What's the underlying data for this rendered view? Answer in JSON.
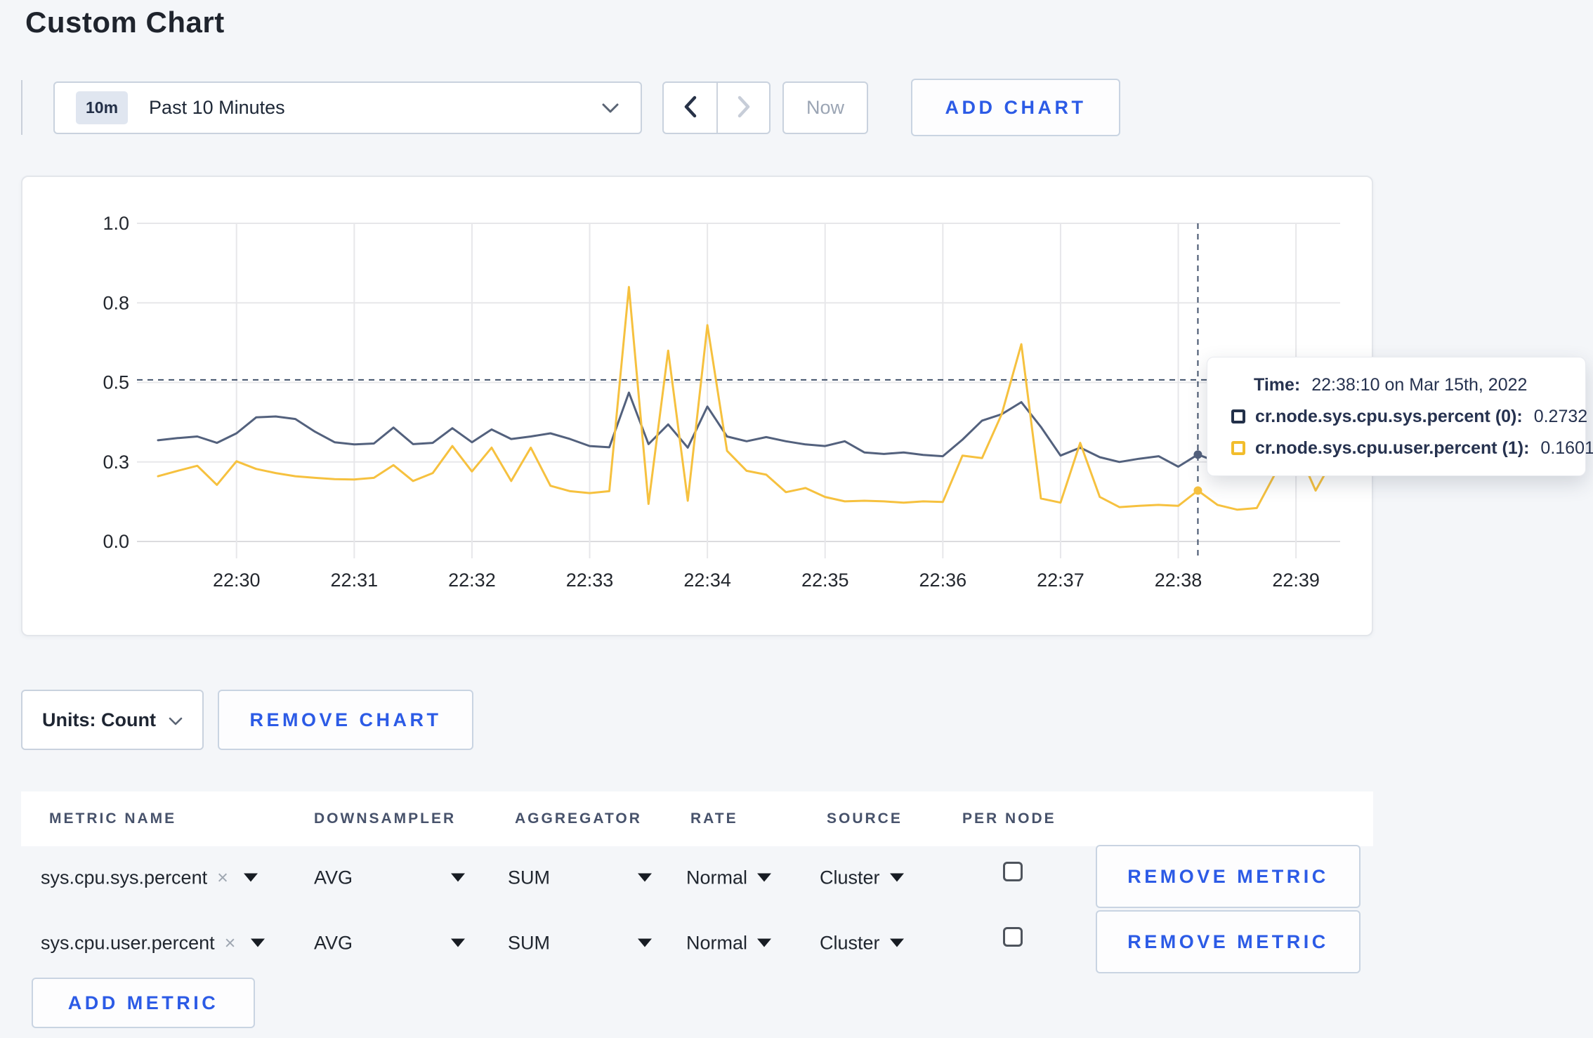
{
  "page": {
    "title": "Custom Chart"
  },
  "toolbar": {
    "time_badge": "10m",
    "time_label": "Past 10 Minutes",
    "prev_label": "previous time range",
    "next_label": "next time range",
    "now_label": "Now",
    "add_chart_label": "ADD CHART"
  },
  "chart_controls": {
    "units_label": "Units: Count",
    "remove_chart_label": "REMOVE CHART"
  },
  "tooltip": {
    "time_label": "Time:",
    "time_value": "22:38:10 on Mar 15th, 2022",
    "series": [
      {
        "label": "cr.node.sys.cpu.sys.percent (0):",
        "value": "0.2732",
        "color": "#223049"
      },
      {
        "label": "cr.node.sys.cpu.user.percent (1):",
        "value": "0.1601",
        "color": "#f2bd2c"
      }
    ]
  },
  "metrics_table": {
    "headers": [
      "METRIC NAME",
      "DOWNSAMPLER",
      "AGGREGATOR",
      "RATE",
      "SOURCE",
      "PER NODE"
    ],
    "rows": [
      {
        "metric": "sys.cpu.sys.percent",
        "remove_tag": "×",
        "downsampler": "AVG",
        "aggregator": "SUM",
        "rate": "Normal",
        "source": "Cluster",
        "per_node_checked": false,
        "remove_label": "REMOVE METRIC"
      },
      {
        "metric": "sys.cpu.user.percent",
        "remove_tag": "×",
        "downsampler": "AVG",
        "aggregator": "SUM",
        "rate": "Normal",
        "source": "Cluster",
        "per_node_checked": false,
        "remove_label": "REMOVE METRIC"
      }
    ],
    "add_metric_label": "ADD METRIC"
  },
  "chart_data": {
    "type": "line",
    "title": "",
    "xlabel": "",
    "ylabel": "",
    "ylim": [
      0,
      1
    ],
    "grid": true,
    "legend_position": "tooltip",
    "x_start_time": "22:29:20",
    "x_step_seconds": 10,
    "x_total_seconds": 600,
    "x_tick_labels": [
      "22:30",
      "22:31",
      "22:32",
      "22:33",
      "22:34",
      "22:35",
      "22:36",
      "22:37",
      "22:38",
      "22:39"
    ],
    "x_tick_offsets_seconds": [
      40,
      100,
      160,
      220,
      280,
      340,
      400,
      460,
      520,
      580
    ],
    "y_ticks": [
      {
        "v": 0.0,
        "label": "0.0"
      },
      {
        "v": 0.25,
        "label": "0.3"
      },
      {
        "v": 0.5,
        "label": "0.5"
      },
      {
        "v": 0.75,
        "label": "0.8"
      },
      {
        "v": 1.0,
        "label": "1.0"
      }
    ],
    "series": [
      {
        "name": "cr.node.sys.cpu.sys.percent",
        "color": "#53617d",
        "values": [
          0.318,
          0.325,
          0.33,
          0.31,
          0.34,
          0.39,
          0.393,
          0.385,
          0.345,
          0.312,
          0.305,
          0.308,
          0.358,
          0.306,
          0.31,
          0.356,
          0.312,
          0.352,
          0.322,
          0.33,
          0.34,
          0.322,
          0.3,
          0.296,
          0.468,
          0.306,
          0.368,
          0.295,
          0.424,
          0.33,
          0.315,
          0.328,
          0.315,
          0.305,
          0.3,
          0.315,
          0.28,
          0.275,
          0.28,
          0.272,
          0.268,
          0.32,
          0.38,
          0.4,
          0.438,
          0.36,
          0.27,
          0.295,
          0.265,
          0.25,
          0.26,
          0.268,
          0.235,
          0.2732,
          0.25,
          0.262,
          0.255,
          0.25,
          0.258,
          0.252,
          0.26
        ]
      },
      {
        "name": "cr.node.sys.cpu.user.percent",
        "color": "#f6c13f",
        "values": [
          0.205,
          0.222,
          0.238,
          0.178,
          0.252,
          0.228,
          0.215,
          0.205,
          0.2,
          0.196,
          0.195,
          0.2,
          0.24,
          0.19,
          0.215,
          0.3,
          0.22,
          0.295,
          0.19,
          0.295,
          0.175,
          0.158,
          0.152,
          0.158,
          0.8,
          0.118,
          0.6,
          0.128,
          0.68,
          0.285,
          0.222,
          0.21,
          0.155,
          0.168,
          0.14,
          0.126,
          0.128,
          0.126,
          0.122,
          0.126,
          0.124,
          0.27,
          0.262,
          0.4,
          0.62,
          0.135,
          0.122,
          0.31,
          0.14,
          0.108,
          0.112,
          0.115,
          0.112,
          0.1601,
          0.115,
          0.1,
          0.105,
          0.22,
          0.3,
          0.16,
          0.27
        ]
      }
    ],
    "crosshair": {
      "point_index": 53,
      "time": "22:38:10",
      "hline_value": 0.508,
      "highlight_values": [
        0.2732,
        0.1601
      ]
    }
  },
  "colors": {
    "accent_blue": "#2c5be6",
    "page_bg": "#f4f6f9",
    "grid_line": "#e7e7ea",
    "zero_line": "#dbdbde",
    "crosshair": "#42526b",
    "axis_text": "#23272e"
  }
}
